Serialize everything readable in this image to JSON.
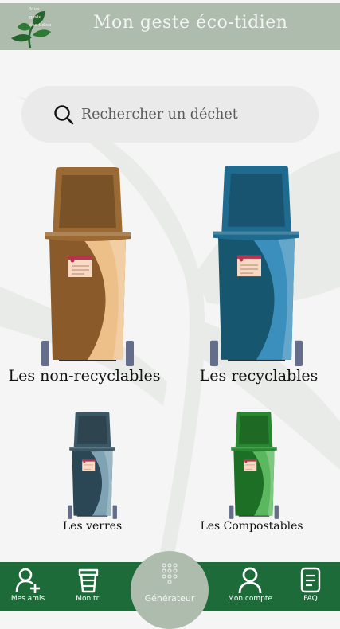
{
  "app": {
    "logo_lines": [
      "Mon",
      "geste",
      "éco-tidien"
    ],
    "title": "Mon geste éco-tidien"
  },
  "search": {
    "placeholder": "Rechercher un déchet",
    "icon": "search-icon"
  },
  "bins": [
    {
      "label": "Les non-recyclables",
      "colors": {
        "lid": "#9b6a34",
        "body": "#8a5a2b",
        "light": "#eec089"
      }
    },
    {
      "label": "Les recyclables",
      "colors": {
        "lid": "#1f6b8f",
        "body": "#17566f",
        "light": "#3a8fbd"
      }
    },
    {
      "label": "Les verres",
      "colors": {
        "lid": "#3b5866",
        "body": "#2b4655",
        "light": "#7fa3b2"
      }
    },
    {
      "label": "Les Compostables",
      "colors": {
        "lid": "#27882f",
        "body": "#1c6f24",
        "light": "#5cb85f"
      }
    }
  ],
  "nav": {
    "items": [
      {
        "label": "Mes amis",
        "icon": "add-friend-icon"
      },
      {
        "label": "Mon tri",
        "icon": "cup-icon"
      },
      {
        "label": "Générateur",
        "icon": "dots-grid-icon"
      },
      {
        "label": "Mon compte",
        "icon": "user-icon"
      },
      {
        "label": "FAQ",
        "icon": "document-icon"
      }
    ]
  },
  "colors": {
    "header_bg": "#aebcad",
    "nav_bg": "#1e6b3a",
    "background": "#f4f5f4"
  }
}
